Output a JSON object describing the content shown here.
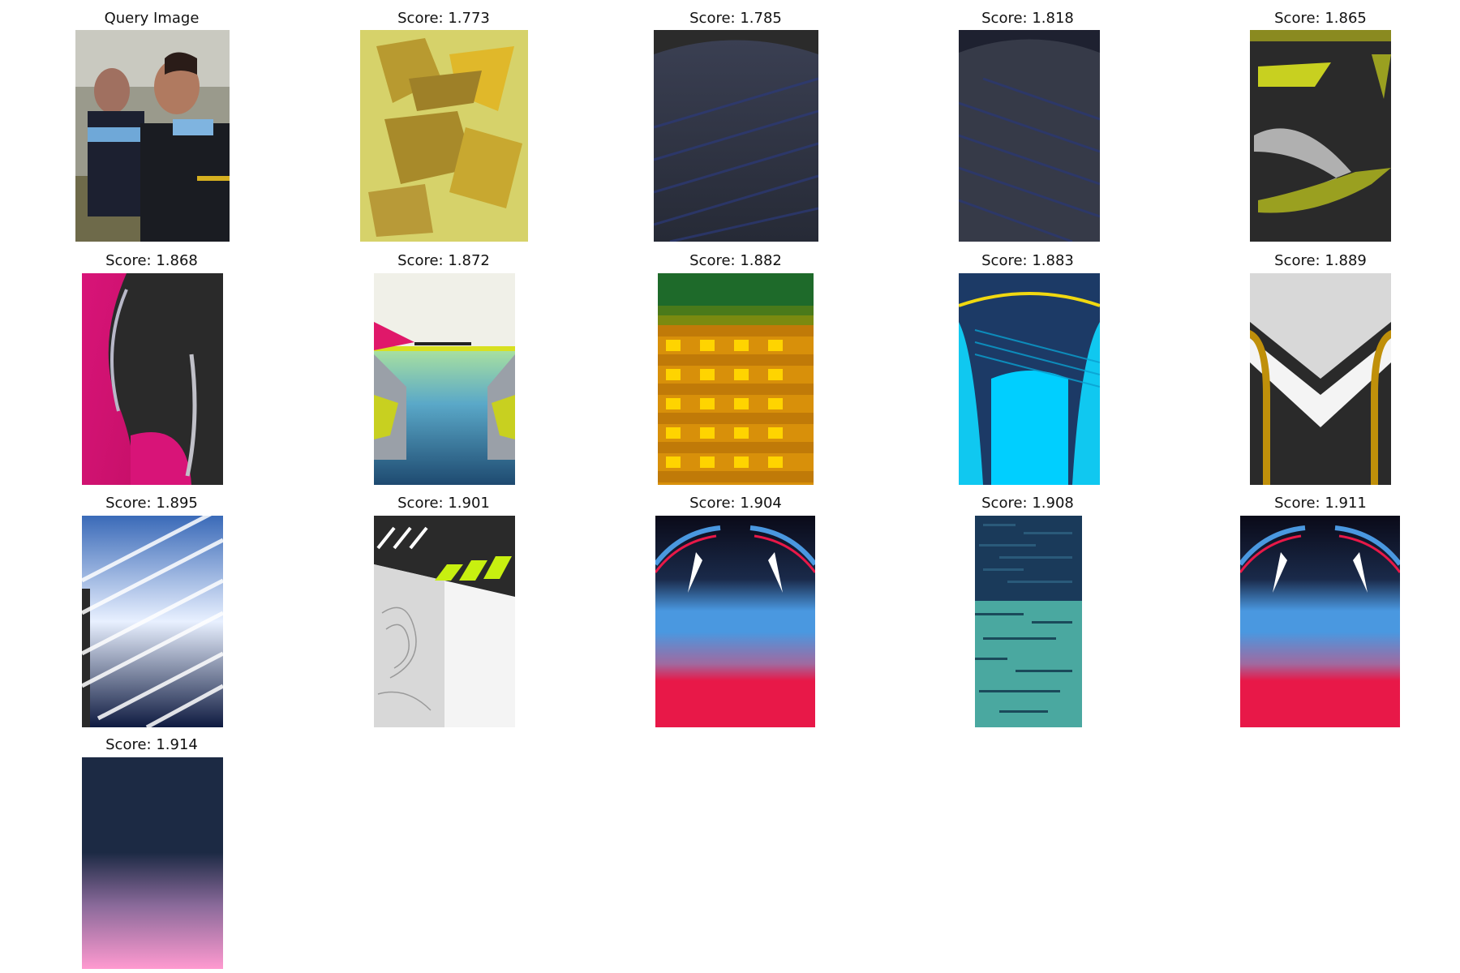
{
  "query": {
    "title": "Query Image"
  },
  "results": [
    {
      "title": "Score: 1.773"
    },
    {
      "title": "Score: 1.785"
    },
    {
      "title": "Score: 1.818"
    },
    {
      "title": "Score: 1.865"
    },
    {
      "title": "Score: 1.868"
    },
    {
      "title": "Score: 1.872"
    },
    {
      "title": "Score: 1.882"
    },
    {
      "title": "Score: 1.883"
    },
    {
      "title": "Score: 1.889"
    },
    {
      "title": "Score: 1.895"
    },
    {
      "title": "Score: 1.901"
    },
    {
      "title": "Score: 1.904"
    },
    {
      "title": "Score: 1.908"
    },
    {
      "title": "Score: 1.911"
    },
    {
      "title": "Score: 1.914"
    }
  ]
}
